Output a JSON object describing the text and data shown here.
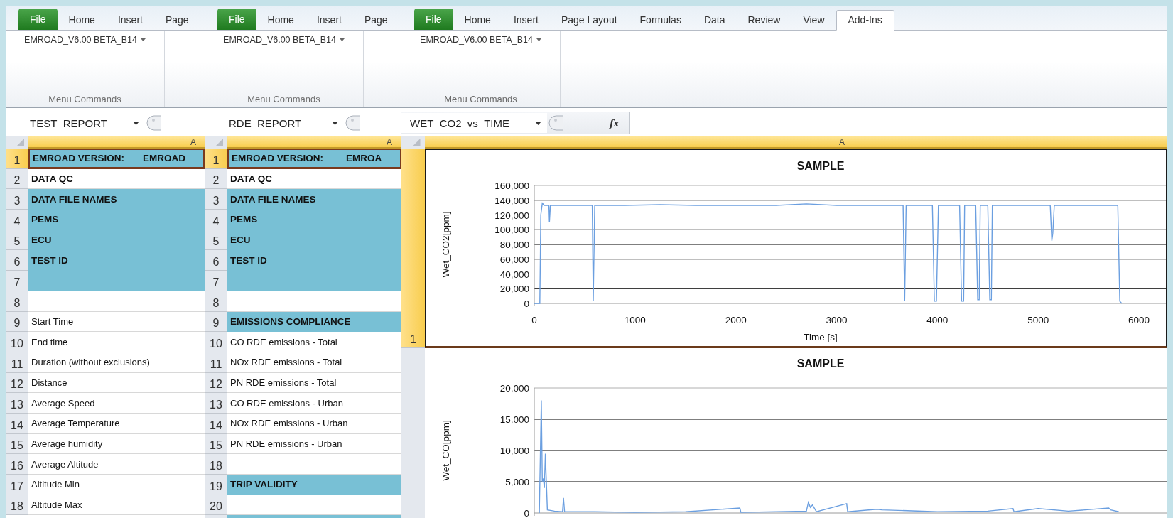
{
  "windows": [
    {
      "tabs": [
        {
          "label": "File",
          "kind": "file",
          "selected": false
        },
        {
          "label": "Home",
          "kind": "tab",
          "selected": false
        },
        {
          "label": "Insert",
          "kind": "tab",
          "selected": false
        },
        {
          "label": "Page",
          "kind": "tab",
          "selected": false
        }
      ],
      "ribbon": {
        "dropdown": "EMROAD_V6.00 BETA_B14",
        "group_label": "Menu Commands"
      },
      "name_box": "TEST_REPORT",
      "column_header": {
        "label": "A",
        "selected": true
      },
      "rows": [
        {
          "number": "1",
          "kind": "header",
          "highlight": true,
          "selected": true,
          "text": "EMROAD VERSION:",
          "value": "EMROAD"
        },
        {
          "number": "2",
          "kind": "header",
          "highlight": false,
          "selected": false,
          "text": "DATA QC"
        },
        {
          "number": "3",
          "kind": "header",
          "highlight": true,
          "selected": false,
          "text": "DATA FILE NAMES"
        },
        {
          "number": "4",
          "kind": "header",
          "highlight": true,
          "selected": false,
          "text": "PEMS"
        },
        {
          "number": "5",
          "kind": "header",
          "highlight": true,
          "selected": false,
          "text": "ECU"
        },
        {
          "number": "6",
          "kind": "header",
          "highlight": true,
          "selected": false,
          "text": "TEST ID"
        },
        {
          "number": "7",
          "kind": "header",
          "highlight": true,
          "selected": false
        },
        {
          "number": "8",
          "kind": "item",
          "highlight": false,
          "selected": false
        },
        {
          "number": "9",
          "kind": "item",
          "highlight": false,
          "selected": false,
          "text": "Start Time"
        },
        {
          "number": "10",
          "kind": "item",
          "highlight": false,
          "selected": false,
          "text": "End time"
        },
        {
          "number": "11",
          "kind": "item",
          "highlight": false,
          "selected": false,
          "text": "Duration (without exclusions)"
        },
        {
          "number": "12",
          "kind": "item",
          "highlight": false,
          "selected": false,
          "text": "Distance"
        },
        {
          "number": "13",
          "kind": "item",
          "highlight": false,
          "selected": false,
          "text": "Average Speed"
        },
        {
          "number": "14",
          "kind": "item",
          "highlight": false,
          "selected": false,
          "text": "Average Temperature"
        },
        {
          "number": "15",
          "kind": "item",
          "highlight": false,
          "selected": false,
          "text": "Average humidity"
        },
        {
          "number": "16",
          "kind": "item",
          "highlight": false,
          "selected": false,
          "text": "Average Altitude"
        },
        {
          "number": "17",
          "kind": "item",
          "highlight": false,
          "selected": false,
          "text": "Altitude Min"
        },
        {
          "number": "18",
          "kind": "item",
          "highlight": false,
          "selected": false,
          "text": "Altitude Max"
        }
      ]
    },
    {
      "tabs": [
        {
          "label": "File",
          "kind": "file",
          "selected": false
        },
        {
          "label": "Home",
          "kind": "tab",
          "selected": false
        },
        {
          "label": "Insert",
          "kind": "tab",
          "selected": false
        },
        {
          "label": "Page",
          "kind": "tab",
          "selected": false
        }
      ],
      "ribbon": {
        "dropdown": "EMROAD_V6.00 BETA_B14",
        "group_label": "Menu Commands"
      },
      "name_box": "RDE_REPORT",
      "column_header": {
        "label": "A",
        "selected": true
      },
      "rows": [
        {
          "number": "1",
          "kind": "header",
          "highlight": true,
          "selected": true,
          "text": "EMROAD VERSION:",
          "value": "EMROA"
        },
        {
          "number": "2",
          "kind": "header",
          "highlight": false,
          "selected": false,
          "text": "DATA QC"
        },
        {
          "number": "3",
          "kind": "header",
          "highlight": true,
          "selected": false,
          "text": "DATA FILE NAMES"
        },
        {
          "number": "4",
          "kind": "header",
          "highlight": true,
          "selected": false,
          "text": "PEMS"
        },
        {
          "number": "5",
          "kind": "header",
          "highlight": true,
          "selected": false,
          "text": "ECU"
        },
        {
          "number": "6",
          "kind": "header",
          "highlight": true,
          "selected": false,
          "text": "TEST ID"
        },
        {
          "number": "7",
          "kind": "header",
          "highlight": true,
          "selected": false
        },
        {
          "number": "8",
          "kind": "item",
          "highlight": false,
          "selected": false
        },
        {
          "number": "9",
          "kind": "header",
          "highlight": true,
          "selected": false,
          "text": "EMISSIONS COMPLIANCE"
        },
        {
          "number": "10",
          "kind": "item",
          "highlight": false,
          "selected": false,
          "text": "CO RDE emissions - Total"
        },
        {
          "number": "11",
          "kind": "item",
          "highlight": false,
          "selected": false,
          "text": "NOx RDE emissions - Total"
        },
        {
          "number": "12",
          "kind": "item",
          "highlight": false,
          "selected": false,
          "text": "PN RDE emissions - Total"
        },
        {
          "number": "13",
          "kind": "item",
          "highlight": false,
          "selected": false,
          "text": "CO RDE emissions - Urban"
        },
        {
          "number": "14",
          "kind": "item",
          "highlight": false,
          "selected": false,
          "text": "NOx RDE emissions - Urban"
        },
        {
          "number": "15",
          "kind": "item",
          "highlight": false,
          "selected": false,
          "text": "PN RDE emissions - Urban"
        },
        {
          "number": "18",
          "kind": "item",
          "highlight": false,
          "selected": false
        },
        {
          "number": "19",
          "kind": "header",
          "highlight": true,
          "selected": false,
          "text": "TRIP VALIDITY"
        },
        {
          "number": "20",
          "kind": "item",
          "highlight": false,
          "selected": false
        },
        {
          "kind": "item",
          "highlight": true,
          "selected": false
        }
      ]
    },
    {
      "tabs": [
        {
          "label": "File",
          "kind": "file",
          "selected": false
        },
        {
          "label": "Home",
          "kind": "tab",
          "selected": false
        },
        {
          "label": "Insert",
          "kind": "tab",
          "selected": false
        },
        {
          "label": "Page Layout",
          "kind": "tab",
          "selected": false
        },
        {
          "label": "Formulas",
          "kind": "tab",
          "selected": false
        },
        {
          "label": "Data",
          "kind": "tab",
          "selected": false
        },
        {
          "label": "Review",
          "kind": "tab",
          "selected": false
        },
        {
          "label": "View",
          "kind": "tab",
          "selected": false
        },
        {
          "label": "Add-Ins",
          "kind": "tab",
          "selected": true
        }
      ],
      "ribbon": {
        "dropdown": "EMROAD_V6.00 BETA_B14",
        "group_label": "Menu Commands"
      },
      "name_box": "WET_CO2_vs_TIME",
      "formula_label": "fx",
      "column_header": {
        "label": "A",
        "selected": true
      },
      "chart_rows": [
        {
          "number": "1",
          "selected": true,
          "chart_data": {
            "type": "line",
            "title": "SAMPLE",
            "xlabel": "Time [s]",
            "ylabel": "Wet_CO2[ppm]",
            "grid": true,
            "xlim": [
              0,
              6338
            ],
            "ylim": [
              0,
              160000
            ],
            "xticks": [
              0,
              1000,
              2000,
              3000,
              4000,
              5000,
              6000
            ],
            "yticks": [
              {
                "value": 0,
                "label": "0"
              },
              {
                "value": 20000,
                "label": "20,000"
              },
              {
                "value": 40000,
                "label": "40,000"
              },
              {
                "value": 60000,
                "label": "60,000"
              },
              {
                "value": 80000,
                "label": "80,000"
              },
              {
                "value": 100000,
                "label": "100,000"
              },
              {
                "value": 120000,
                "label": "120,000"
              },
              {
                "value": 140000,
                "label": "140,000"
              },
              {
                "value": 160000,
                "label": "160,000"
              }
            ],
            "x": [
              0,
              55,
              65,
              80,
              100,
              145,
              150,
              160,
              300,
              560,
              575,
              585,
              600,
              900,
              1250,
              1600,
              2000,
              2400,
              2700,
              3000,
              3400,
              3660,
              3675,
              3690,
              3700,
              3950,
              3970,
              3990,
              4010,
              4220,
              4240,
              4260,
              4270,
              4380,
              4400,
              4415,
              4425,
              4500,
              4520,
              4535,
              4545,
              4800,
              5120,
              5135,
              5145,
              5160,
              5500,
              5790,
              5810,
              5830
            ],
            "series": [
              {
                "color": "#6b9fe0",
                "values": [
                  0,
                  0,
                  120000,
                  136000,
                  133000,
                  133000,
                  110000,
                  133000,
                  133000,
                  133000,
                  133000,
                  3000,
                  133000,
                  133000,
                  134000,
                  133000,
                  133000,
                  133000,
                  135000,
                  133000,
                  133000,
                  133000,
                  3000,
                  133000,
                  133000,
                  133000,
                  3000,
                  3000,
                  133000,
                  133000,
                  3000,
                  3000,
                  133000,
                  133000,
                  5000,
                  5000,
                  133000,
                  133000,
                  5000,
                  5000,
                  133000,
                  133000,
                  133000,
                  85000,
                  95000,
                  133000,
                  133000,
                  133000,
                  3000,
                  0
                ]
              }
            ]
          }
        },
        {
          "selected": false,
          "chart_data": {
            "type": "line",
            "title": "SAMPLE",
            "ylabel": "Wet_CO[ppm]",
            "grid": true,
            "xlim": [
              0,
              6338
            ],
            "ylim": [
              0,
              20000
            ],
            "yticks": [
              {
                "value": 0,
                "label": "0"
              },
              {
                "value": 5000,
                "label": "5,000"
              },
              {
                "value": 10000,
                "label": "10,000"
              },
              {
                "value": 15000,
                "label": "15,000"
              },
              {
                "value": 20000,
                "label": "20,000"
              }
            ],
            "x": [
              50,
              60,
              70,
              80,
              90,
              100,
              110,
              130,
              200,
              280,
              290,
              300,
              600,
              1000,
              1500,
              2040,
              2050,
              2400,
              2700,
              2720,
              2740,
              2760,
              2800,
              3100,
              3110,
              3400,
              3450,
              4000,
              4500,
              4750,
              4760,
              5000,
              5300,
              5700,
              5720,
              5800
            ],
            "series": [
              {
                "color": "#6b9fe0",
                "values": [
                  0,
                  9000,
                  18000,
                  5000,
                  5500,
                  4000,
                  9500,
                  500,
                  300,
                  200,
                  2400,
                  200,
                  200,
                  100,
                  200,
                  800,
                  100,
                  200,
                  300,
                  1700,
                  900,
                  1300,
                  200,
                  1500,
                  200,
                  600,
                  500,
                  200,
                  300,
                  700,
                  200,
                  700,
                  300,
                  800,
                  500,
                  200
                ]
              }
            ]
          }
        }
      ]
    }
  ]
}
